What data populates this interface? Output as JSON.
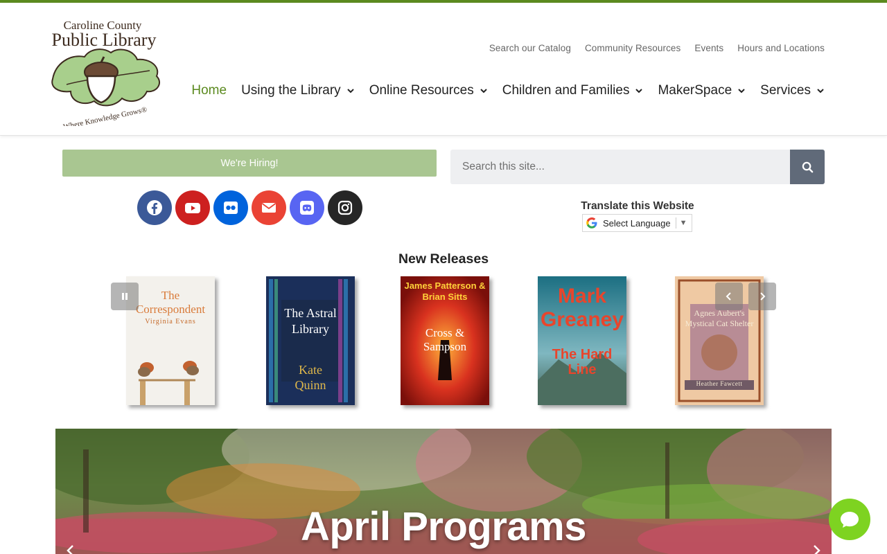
{
  "logo": {
    "line1": "Caroline County",
    "line2": "Public Library",
    "tagline": "Where Knowledge Grows®"
  },
  "utility_nav": [
    {
      "label": "Search our Catalog"
    },
    {
      "label": "Community Resources"
    },
    {
      "label": "Events"
    },
    {
      "label": "Hours and Locations"
    }
  ],
  "main_nav": [
    {
      "label": "Home",
      "active": true
    },
    {
      "label": "Using the Library",
      "dropdown": true
    },
    {
      "label": "Online Resources",
      "dropdown": true
    },
    {
      "label": "Children and Families",
      "dropdown": true
    },
    {
      "label": "MakerSpace",
      "dropdown": true
    },
    {
      "label": "Services",
      "dropdown": true
    }
  ],
  "hiring": {
    "label": "We're Hiring!"
  },
  "search": {
    "placeholder": "Search this site..."
  },
  "social": [
    {
      "icon": "facebook-icon",
      "color": "#3b5998"
    },
    {
      "icon": "youtube-icon",
      "color": "#cd201f"
    },
    {
      "icon": "flickr-icon",
      "color": "#0063dc"
    },
    {
      "icon": "envelope-icon",
      "color": "#ea4335"
    },
    {
      "icon": "discord-icon",
      "color": "#5865f2"
    },
    {
      "icon": "instagram-icon",
      "color": "#262626"
    }
  ],
  "translate": {
    "title": "Translate this Website",
    "select_label": "Select Language"
  },
  "new_releases": {
    "title": "New Releases",
    "books": [
      {
        "title": "The Correspondent",
        "author": "Virginia Evans"
      },
      {
        "title": "The Astral Library",
        "author": "Kate Quinn"
      },
      {
        "title": "Cross & Sampson",
        "author": "James Patterson & Brian Sitts"
      },
      {
        "title": "The Hard Line",
        "author": "Mark Greaney"
      },
      {
        "title": "Agnes Aubert's Mystical Cat Shelter",
        "author": "Heather Fawcett"
      }
    ]
  },
  "banner": {
    "title": "April Programs"
  },
  "colors": {
    "accent_green": "#5b8a1f",
    "hiring_green": "#a9c691",
    "search_button": "#606a79",
    "chat_green": "#7ed321"
  }
}
